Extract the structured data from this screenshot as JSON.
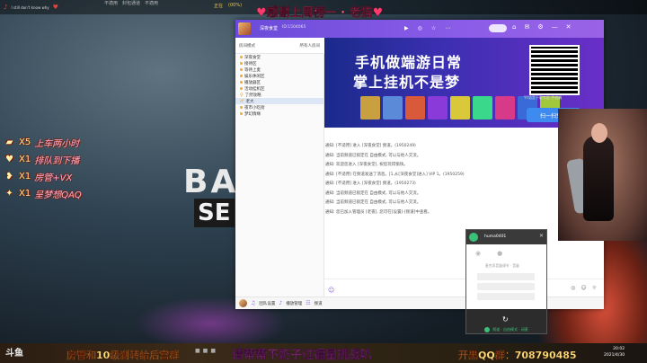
{
  "player": {
    "track": "I still don't know why",
    "heart": "♥"
  },
  "top_links": [
    "不適用",
    "封包通道",
    "不適用"
  ],
  "coins": [
    "正在",
    "(00%)"
  ],
  "banner": {
    "text": "感谢上周榜一 · 老猫",
    "heart_left": "♥",
    "heart_right": "♥"
  },
  "gifts": [
    {
      "mult": "X5",
      "desc": "上车两小时",
      "icon": "gold-bar-icon"
    },
    {
      "mult": "X1",
      "desc": "排队到下播",
      "icon": "lips-icon"
    },
    {
      "mult": "X1",
      "desc": "房管+VX",
      "icon": "heart-arrow-icon"
    },
    {
      "mult": "X1",
      "desc": "呈梦想QAQ",
      "icon": "star-wand-icon"
    }
  ],
  "bg_text": {
    "ba": "BA",
    "se": "SE"
  },
  "chat": {
    "title": "深夜食堂",
    "room_id": "ID:1504065",
    "header_actions": [
      "▶",
      "◎",
      "☆",
      "⋯"
    ],
    "tools": [
      "⌂",
      "✉",
      "⚙",
      "—",
      "✕"
    ],
    "tabs": {
      "left": "房间模式",
      "right": "所有人房间"
    },
    "sidebar": [
      {
        "label": "深夜食堂",
        "selected": false
      },
      {
        "label": "接待区",
        "selected": false
      },
      {
        "label": "等待上麦",
        "selected": false
      },
      {
        "label": "娱乐休闲区",
        "selected": false
      },
      {
        "label": "播放器区",
        "selected": false
      },
      {
        "label": "活动挂机区",
        "selected": false
      },
      {
        "label": "了然攻略",
        "selected": false
      },
      {
        "label": "老大",
        "selected": true
      },
      {
        "label": "夜市小吃街",
        "selected": false
      },
      {
        "label": "梦幻情缘",
        "selected": false
      }
    ],
    "ad": {
      "line1": "手机做端游日常",
      "line2": "掌上挂机不是梦",
      "qr_caption": "YY语音下载专区·手机端",
      "scan_button": "扫一扫免费"
    },
    "messages": [
      "通知: [不适用] 进入 [深夜食堂] 频道。(1950249)",
      "通知: 当前频道已锁定在 自由模式, 可以与他人交流。",
      "通知: 欢迎您进入 [深夜食堂], 祝您玩得愉快。",
      "通知: [不适用] 在频道发送了消息。[1.从[深夜食堂]进入] VIP 1。(1950259)",
      "通知: [不适用] 进入 [深夜食堂] 频道。(1950273)",
      "通知: 当前频道已锁定在 自由模式, 可以与他人交流。",
      "通知: 当前频道已锁定在 自由模式, 可以与他人交流。",
      "通知: 您已加入管理员 [老夜], 您可在[设置]-[频道]中查看。"
    ],
    "input_actions": [
      "◎",
      "☺",
      "☼"
    ],
    "footer": {
      "labels": [
        "团队设置",
        "播放管理",
        "频道"
      ],
      "app": "频道中心"
    }
  },
  "voice_popup": {
    "name": "huma0401",
    "label": "麦克风音量调节 · 音量",
    "footer": "频道 · 自由模式 · 闭麦"
  },
  "bottom": {
    "logo": "斗鱼",
    "left": "房管和10级刹转给后宫群",
    "middle": "请帮帮不奶子过福星挑战叭",
    "right": "开黑QQ群：708790485",
    "clock_time": "20:02",
    "clock_date": "2021/4/30"
  }
}
